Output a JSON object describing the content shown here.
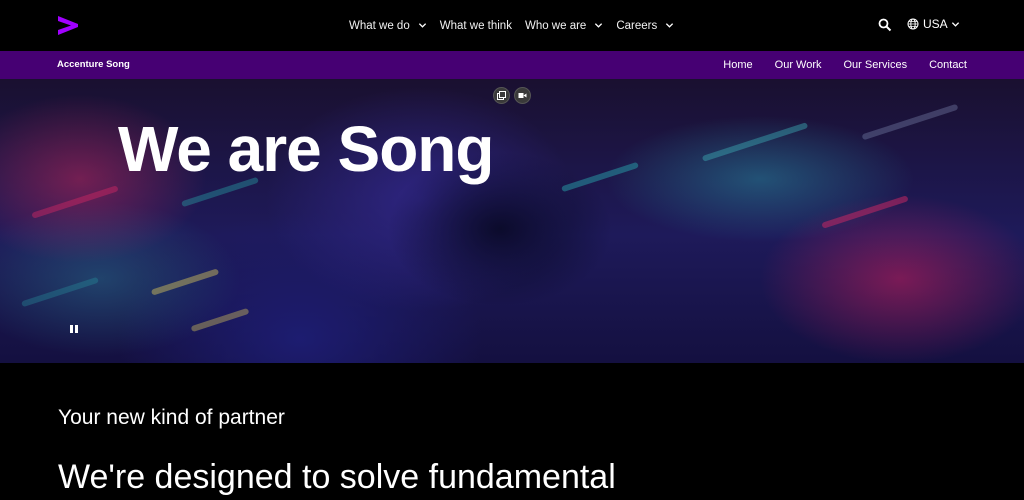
{
  "topnav": {
    "menu": [
      {
        "label": "What we do",
        "has_dropdown": true
      },
      {
        "label": "What we think",
        "has_dropdown": false
      },
      {
        "label": "Who we are",
        "has_dropdown": true
      },
      {
        "label": "Careers",
        "has_dropdown": true
      }
    ],
    "locale_label": "USA",
    "icons": {
      "logo": "accenture-greater-than-logo",
      "search": "search-icon",
      "globe": "globe-icon",
      "chevron": "chevron-down-icon"
    }
  },
  "subnav": {
    "brand": "Accenture Song",
    "links": [
      "Home",
      "Our Work",
      "Our Services",
      "Contact"
    ]
  },
  "hero": {
    "title": "We are Song",
    "controls": [
      "picture-in-picture-icon",
      "video-camera-icon",
      "pause-icon"
    ]
  },
  "content": {
    "kicker": "Your new kind of partner",
    "headline": "We're designed to solve fundamental"
  },
  "colors": {
    "brand_purple": "#a100ff",
    "subnav_bg": "#460073",
    "page_bg": "#000000"
  }
}
